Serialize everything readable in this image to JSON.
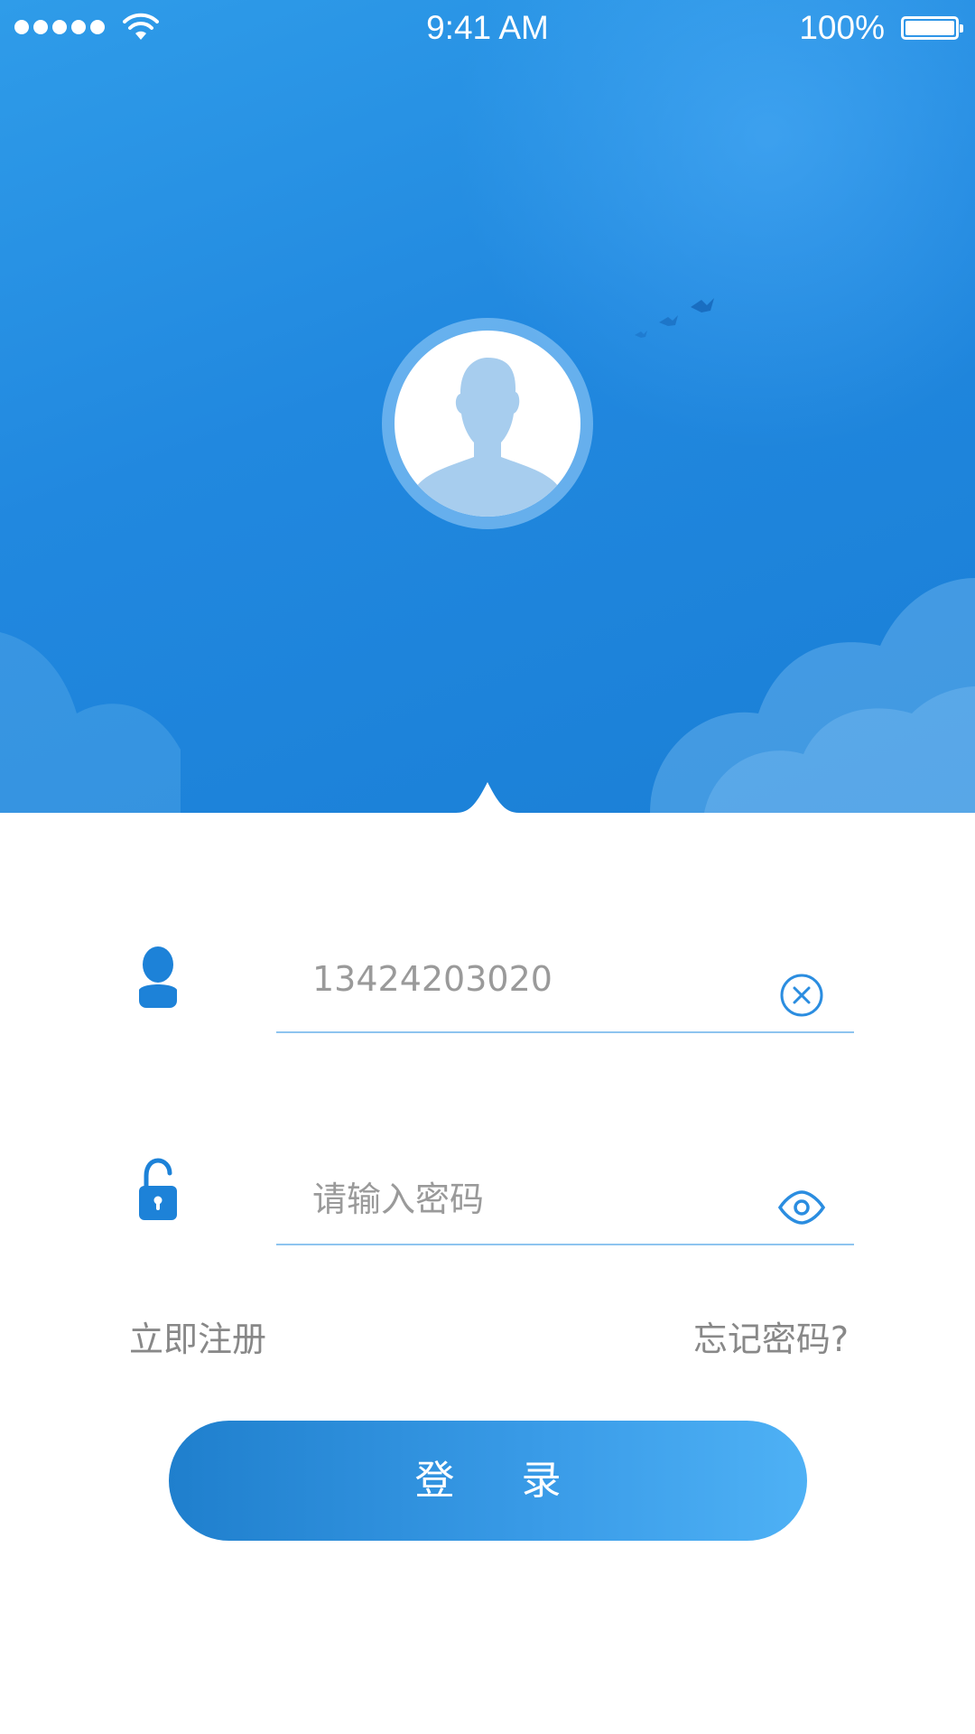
{
  "status_bar": {
    "time": "9:41 AM",
    "battery_percent": "100%",
    "signal_dots": 5,
    "battery_level": 1.0
  },
  "header": {
    "avatar_icon": "default-user-avatar-icon",
    "decor": [
      "birds",
      "clouds"
    ]
  },
  "form": {
    "phone": {
      "icon": "user-icon",
      "value": "13424203020",
      "clear_icon": "clear-circle-x-icon"
    },
    "password": {
      "icon": "unlock-icon",
      "placeholder": "请输入密码",
      "visibility_icon": "eye-icon"
    },
    "register_label": "立即注册",
    "forgot_label": "忘记密码?",
    "login_label": "登 录"
  },
  "colors": {
    "primary": "#2188df",
    "accent_light": "#4eb1f5",
    "underline": "#8ec4ef",
    "muted_text": "#9a9a9a"
  }
}
